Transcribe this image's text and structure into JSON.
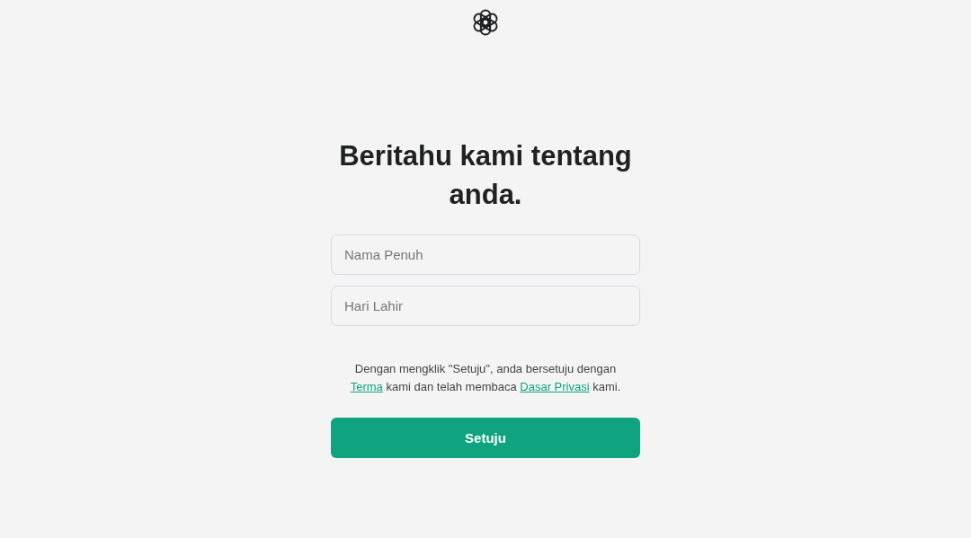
{
  "heading": "Beritahu kami tentang anda.",
  "fields": [
    {
      "placeholder": "Nama Penuh"
    },
    {
      "placeholder": "Hari Lahir"
    }
  ],
  "consent": [
    {
      "kind": "text",
      "text": "Dengan mengklik \"Setuju\", anda bersetuju dengan"
    },
    {
      "kind": "break"
    },
    {
      "kind": "link",
      "text": "Terma"
    },
    {
      "kind": "text",
      "text": " kami dan telah membaca "
    },
    {
      "kind": "link",
      "text": "Dasar Privasi"
    },
    {
      "kind": "text",
      "text": " kami."
    }
  ],
  "button": "Setuju"
}
